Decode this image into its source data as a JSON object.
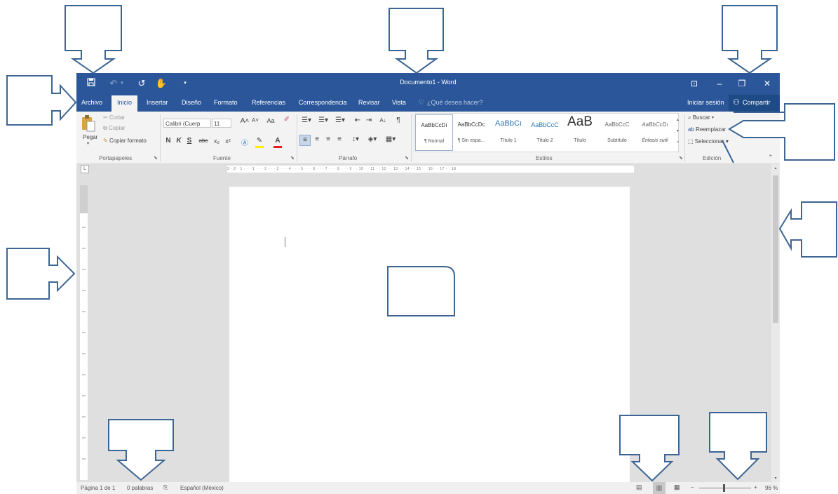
{
  "window_title": "Documento1 - Word",
  "quick_access": {
    "save_icon": "save-icon",
    "undo_icon": "undo-icon",
    "redo_icon": "redo-icon",
    "touch_icon": "touch-mode-icon",
    "customize_icon": "customize-qat-icon"
  },
  "window_controls": {
    "ribbon_display": "⊡",
    "minimize": "–",
    "restore": "❐",
    "close": "✕"
  },
  "tabs": [
    "Archivo",
    "Inicio",
    "Insertar",
    "Diseño",
    "Formato",
    "Referencias",
    "Correspondencia",
    "Revisar",
    "Vista"
  ],
  "active_tab": "Inicio",
  "tell_me": "¿Qué desea hacer?",
  "sign_in": "Iniciar sesión",
  "share": "Compartir",
  "clipboard": {
    "paste": "Pegar",
    "cut": "Cortar",
    "copy": "Copiar",
    "format_painter": "Copiar formato",
    "group": "Portapapeles"
  },
  "font": {
    "name": "Calibri (Cuerp",
    "size": "11",
    "grow": "A˄",
    "shrink": "A˅",
    "case": "Aa",
    "bold": "N",
    "italic": "K",
    "underline": "S",
    "strike": "abc",
    "subscript": "x₂",
    "superscript": "x²",
    "group": "Fuente"
  },
  "paragraph": {
    "sort": "A↓",
    "pilcrow": "¶",
    "group": "Párrafo"
  },
  "styles": {
    "items": [
      {
        "preview": "AaBbCcDı",
        "name": "¶ Normal"
      },
      {
        "preview": "AaBbCcDc",
        "name": "¶ Sin espa..."
      },
      {
        "preview": "AaBbCı",
        "name": "Título 1"
      },
      {
        "preview": "AaBbCcC",
        "name": "Título 2"
      },
      {
        "preview": "AaB",
        "name": "Título"
      },
      {
        "preview": "AaBbCcC",
        "name": "Subtítulo"
      },
      {
        "preview": "AaBbCcDı",
        "name": "Énfasis sutil"
      }
    ],
    "group": "Estilos"
  },
  "editing": {
    "find": "Buscar",
    "replace": "Reemplazar",
    "select": "Seleccionar",
    "group": "Edición"
  },
  "ruler": {
    "tab_selector": "L",
    "numbers": "3 · 2 · 1 · · · 1 · · · 2 · · · 3 · · · 4 · · · 5 · · · 6 · · · 7 · · · 8 · · · 9 · · 10 · · 11 · · 12 · · 13 · · 14 · · 15 · · 16 · · 17 · · 18"
  },
  "status": {
    "page": "Página 1 de 1",
    "words": "0 palabras",
    "language": "Español (México)",
    "zoom_minus": "–",
    "zoom_plus": "+",
    "zoom": "96 %"
  },
  "zoom_level": 0.96,
  "colors": {
    "brand": "#2b579a",
    "ribbon": "#f3f3f3",
    "workspace": "#dfdfdf",
    "callout_stroke": "#3d6593"
  }
}
